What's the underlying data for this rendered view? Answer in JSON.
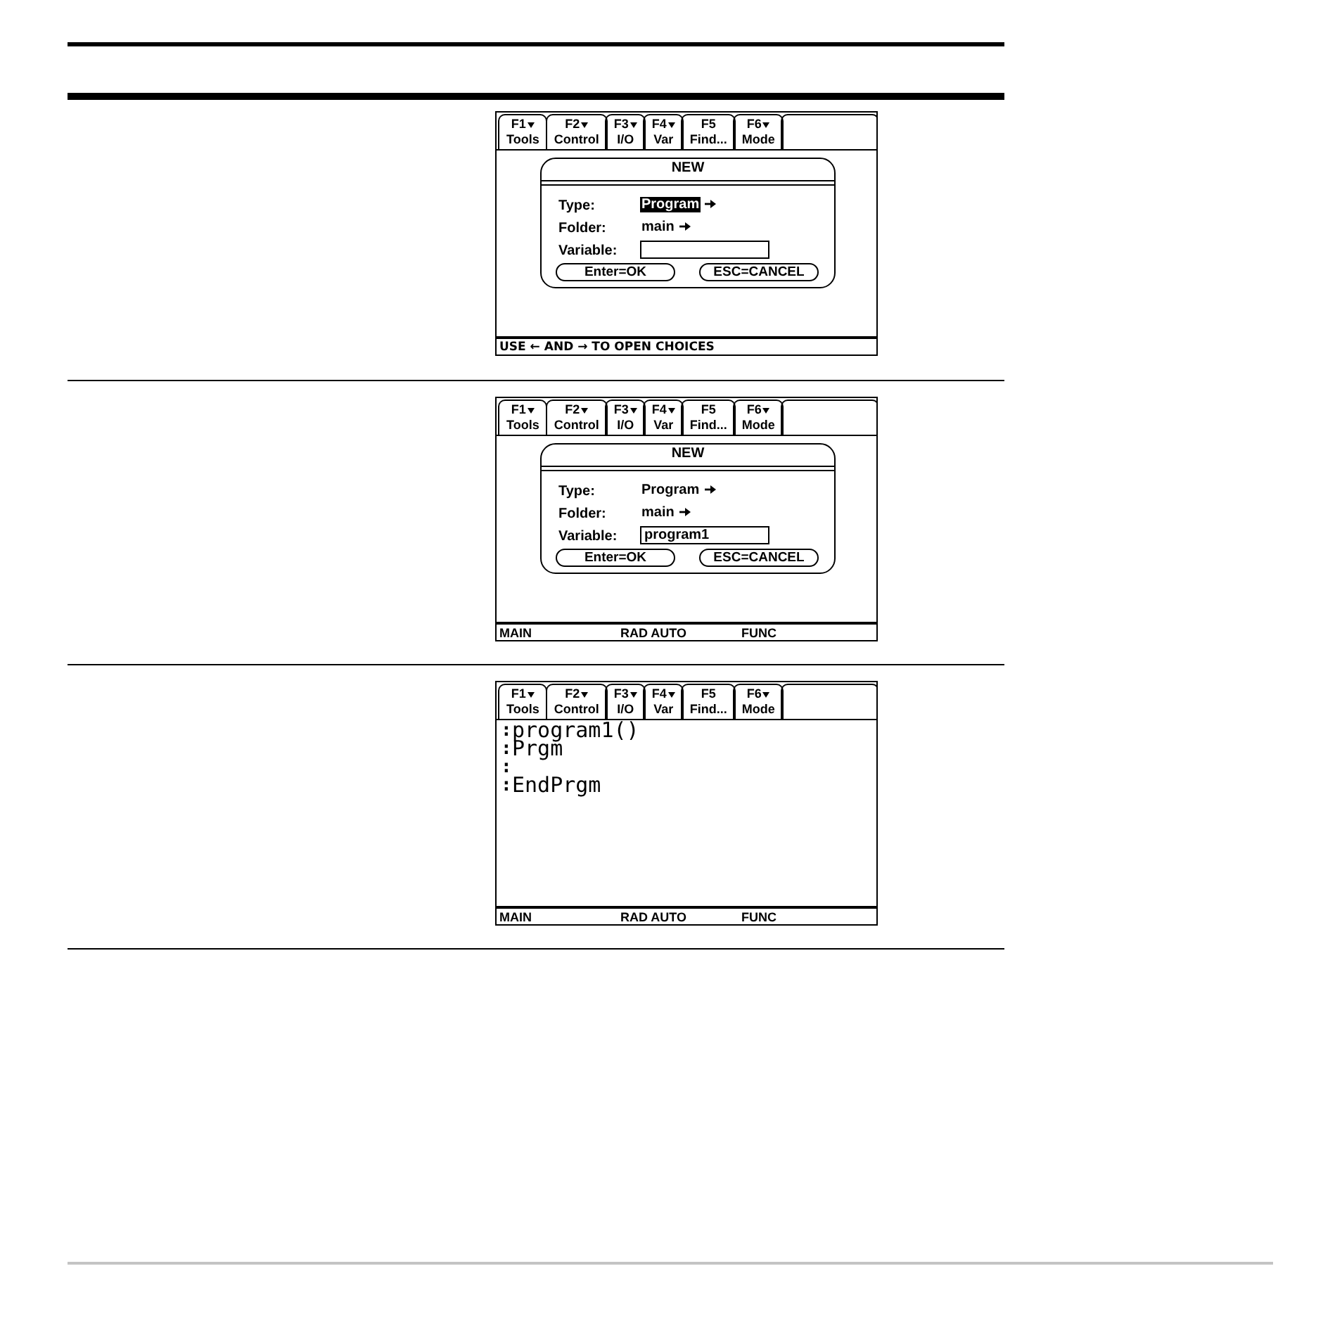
{
  "table": {
    "rows": [
      {
        "screen": {
          "toolbar": [
            {
              "key": "F1",
              "menu": true,
              "label": "Tools"
            },
            {
              "key": "F2",
              "menu": true,
              "label": "Control"
            },
            {
              "key": "F3",
              "menu": true,
              "label": "I/O"
            },
            {
              "key": "F4",
              "menu": true,
              "label": "Var"
            },
            {
              "key": "F5",
              "menu": false,
              "label": "Find..."
            },
            {
              "key": "F6",
              "menu": true,
              "label": "Mode"
            }
          ],
          "dialog": {
            "title": "NEW",
            "fields": [
              {
                "kind": "choice",
                "label": "Type:",
                "value": "Program",
                "focused": true
              },
              {
                "kind": "choice",
                "label": "Folder:",
                "value": "main",
                "focused": false
              },
              {
                "kind": "text",
                "label": "Variable:"
              }
            ],
            "buttons": [
              "Enter=OK",
              "ESC=CANCEL"
            ]
          },
          "status_bar": {
            "message": "USE ← AND → TO OPEN CHOICES"
          }
        }
      },
      {
        "screen": {
          "toolbar": [
            {
              "key": "F1",
              "menu": true,
              "label": "Tools"
            },
            {
              "key": "F2",
              "menu": true,
              "label": "Control"
            },
            {
              "key": "F3",
              "menu": true,
              "label": "I/O"
            },
            {
              "key": "F4",
              "menu": true,
              "label": "Var"
            },
            {
              "key": "F5",
              "menu": false,
              "label": "Find..."
            },
            {
              "key": "F6",
              "menu": true,
              "label": "Mode"
            }
          ],
          "dialog": {
            "title": "NEW",
            "fields": [
              {
                "kind": "choice",
                "label": "Type:",
                "value": "Program",
                "focused": false
              },
              {
                "kind": "choice",
                "label": "Folder:",
                "value": "main",
                "focused": false
              },
              {
                "kind": "text",
                "label": "Variable:",
                "value": "program1"
              }
            ],
            "buttons": [
              "Enter=OK",
              "ESC=CANCEL"
            ]
          },
          "status_bar": {
            "items": [
              "MAIN",
              "RAD AUTO",
              "FUNC"
            ]
          }
        }
      },
      {
        "screen": {
          "toolbar": [
            {
              "key": "F1",
              "menu": true,
              "label": "Tools"
            },
            {
              "key": "F2",
              "menu": true,
              "label": "Control"
            },
            {
              "key": "F3",
              "menu": true,
              "label": "I/O"
            },
            {
              "key": "F4",
              "menu": true,
              "label": "Var"
            },
            {
              "key": "F5",
              "menu": false,
              "label": "Find..."
            },
            {
              "key": "F6",
              "menu": true,
              "label": "Mode"
            }
          ],
          "editor": {
            "lines": [
              {
                "marker": ":",
                "text": "program1()"
              },
              {
                "marker": ":",
                "text": "Prgm"
              },
              {
                "marker": ":"
              },
              {
                "marker": ":",
                "text": "EndPrgm"
              }
            ]
          },
          "status_bar": {
            "items": [
              "MAIN",
              "RAD AUTO",
              "FUNC"
            ]
          }
        }
      }
    ]
  }
}
